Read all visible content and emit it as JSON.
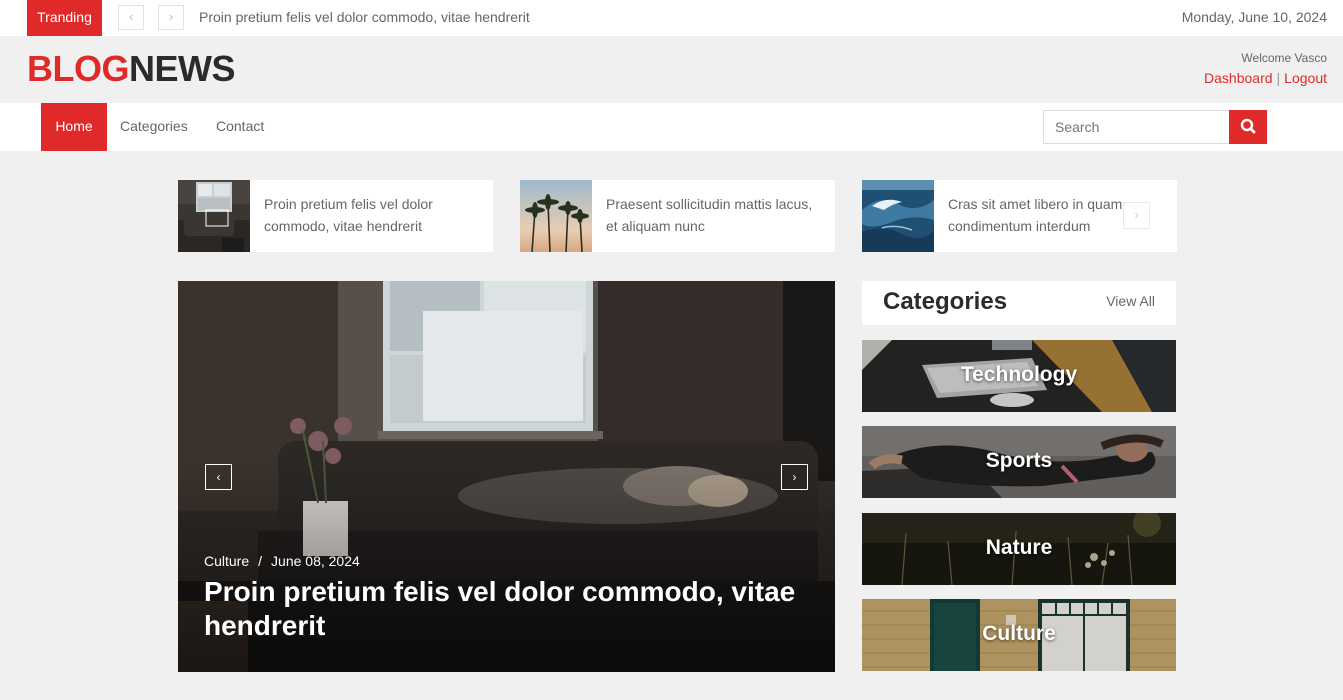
{
  "topbar": {
    "trending_label": "Tranding",
    "prev_icon": "‹",
    "next_icon": "›",
    "trending_headline": "Proin pretium felis vel dolor commodo, vitae hendrerit",
    "date": "Monday, June 10, 2024"
  },
  "header": {
    "logo_part1": "BLOG",
    "logo_part2": "NEWS",
    "welcome": "Welcome Vasco",
    "dashboard": "Dashboard",
    "separator": "|",
    "logout": "Logout"
  },
  "nav": {
    "items": [
      {
        "label": "Home"
      },
      {
        "label": "Categories"
      },
      {
        "label": "Contact"
      }
    ],
    "search_placeholder": "Search"
  },
  "mini_news": [
    {
      "title": "Proin pretium felis vel dolor commodo, vitae hendrerit"
    },
    {
      "title": "Praesent sollicitudin mattis lacus, et aliquam nunc"
    },
    {
      "title": "Cras sit amet libero in quam condimentum interdum"
    }
  ],
  "hero": {
    "category": "Culture",
    "slash": "/",
    "date": "June 08, 2024",
    "title": "Proin pretium felis vel dolor commodo, vitae hendrerit",
    "prev_icon": "‹",
    "next_icon": "›"
  },
  "categories": {
    "title": "Categories",
    "view_all": "View All",
    "items": [
      {
        "label": "Technology"
      },
      {
        "label": "Sports"
      },
      {
        "label": "Nature"
      },
      {
        "label": "Culture"
      }
    ]
  },
  "colors": {
    "accent": "#e02a2a",
    "dark": "#2b2b2b",
    "background": "#f0f0f0"
  }
}
